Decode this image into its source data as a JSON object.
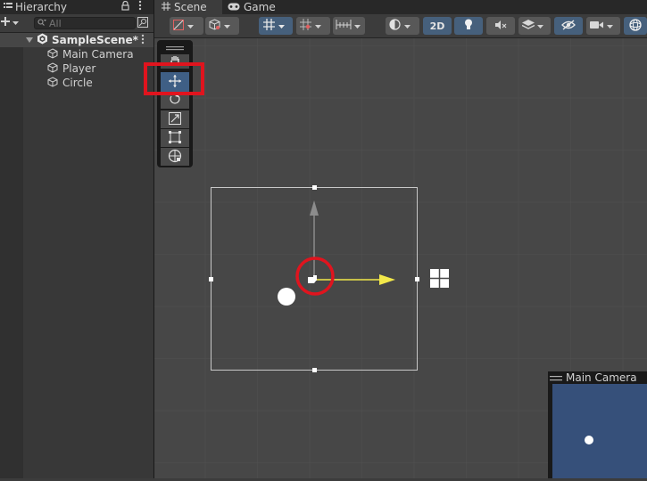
{
  "hierarchy": {
    "tab_label": "Hierarchy",
    "search_placeholder": "All",
    "scene_name": "SampleScene*",
    "items": [
      {
        "label": "Main Camera",
        "icon": "gameobject-icon"
      },
      {
        "label": "Player",
        "icon": "gameobject-icon"
      },
      {
        "label": "Circle",
        "icon": "gameobject-icon"
      }
    ]
  },
  "scene_view": {
    "tabs": [
      {
        "label": "Scene",
        "icon": "grid-icon",
        "active": true
      },
      {
        "label": "Game",
        "icon": "gamepad-icon",
        "active": false
      }
    ],
    "toolbar": {
      "mode_2d_label": "2D",
      "mode_2d_active": true
    },
    "tools": [
      {
        "name": "hand-tool",
        "icon": "hand-icon",
        "active": false
      },
      {
        "name": "move-tool",
        "icon": "move-icon",
        "active": true
      },
      {
        "name": "rotate-tool",
        "icon": "rotate-icon",
        "active": false
      },
      {
        "name": "scale-tool",
        "icon": "scale-icon",
        "active": false
      },
      {
        "name": "rect-tool",
        "icon": "rect-icon",
        "active": false
      },
      {
        "name": "transform-tool",
        "icon": "transform-icon",
        "active": false
      }
    ],
    "camera_preview_title": "Main Camera"
  },
  "colors": {
    "panel_bg": "#383838",
    "viewport_bg": "#474747",
    "accent_blue": "#46607c",
    "camera_bg": "#36507a",
    "gizmo_x": "#f2e84a",
    "highlight_red": "#e0141e"
  }
}
